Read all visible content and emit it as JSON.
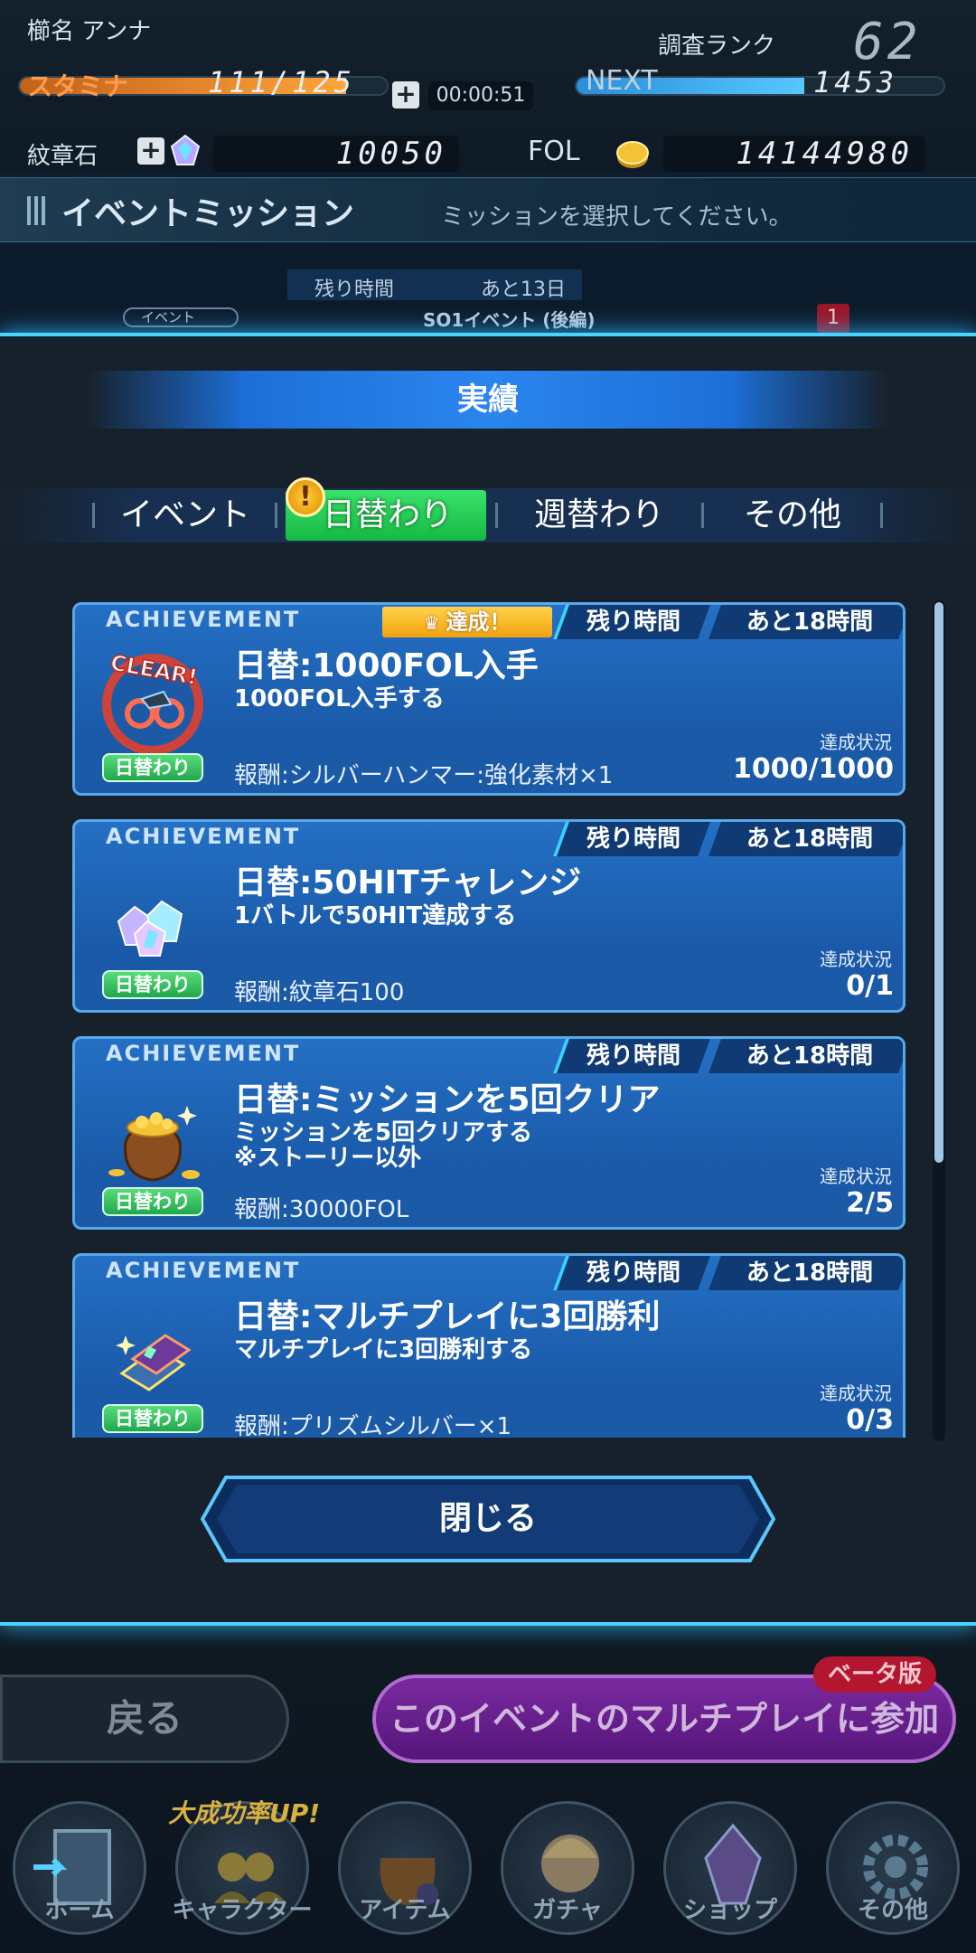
{
  "status": {
    "player_name": "櫛名 アンナ",
    "rank_label": "調査ランク",
    "rank_value": "62",
    "stamina_label": "スタミナ",
    "stamina_value": "111/125",
    "stamina_fraction": 0.89,
    "timer": "00:00:51",
    "next_label": "NEXT",
    "next_value": "1453",
    "next_fraction": 0.62,
    "crest_label": "紋章石",
    "crest_value": "10050",
    "fol_label": "FOL",
    "fol_value": "14144980"
  },
  "event_header": {
    "title": "イベントミッション",
    "instruction": "ミッションを選択してください。",
    "remaining_label": "残り時間",
    "remaining_value": "あと13日",
    "event_tag": "イベント",
    "event_name": "SO1イベント (後編)",
    "count": "1"
  },
  "modal": {
    "title": "実績",
    "tabs": [
      {
        "label": "イベント",
        "active": false
      },
      {
        "label": "日替わり",
        "active": true,
        "badge": "!"
      },
      {
        "label": "週替わり",
        "active": false
      },
      {
        "label": "その他",
        "active": false
      }
    ],
    "missions": [
      {
        "category": "ACHIEVEMENT",
        "achieved_label": "達成！",
        "remaining_label": "残り時間",
        "remaining_value": "あと18時間",
        "title": "日替:1000FOL入手",
        "desc": "1000FOL入手する",
        "progress_label": "達成状況",
        "progress": "1000/1000",
        "reward": "報酬:シルバーハンマー:強化素材×1",
        "chip": "日替わり",
        "icon": "clear-medal-icon",
        "clear_text": "CLEAR!"
      },
      {
        "category": "ACHIEVEMENT",
        "remaining_label": "残り時間",
        "remaining_value": "あと18時間",
        "title": "日替:50HITチャレンジ",
        "desc": "1バトルで50HIT達成する",
        "progress_label": "達成状況",
        "progress": "0/1",
        "reward": "報酬:紋章石100",
        "chip": "日替わり",
        "icon": "crest-stones-icon"
      },
      {
        "category": "ACHIEVEMENT",
        "remaining_label": "残り時間",
        "remaining_value": "あと18時間",
        "title": "日替:ミッションを5回クリア",
        "desc": "ミッションを5回クリアする\n※ストーリー以外",
        "progress_label": "達成状況",
        "progress": "2/5",
        "reward": "報酬:30000FOL",
        "chip": "日替わり",
        "icon": "gold-bag-icon"
      },
      {
        "category": "ACHIEVEMENT",
        "remaining_label": "残り時間",
        "remaining_value": "あと18時間",
        "title": "日替:マルチプレイに3回勝利",
        "desc": "マルチプレイに3回勝利する",
        "progress_label": "達成状況",
        "progress": "0/3",
        "reward": "報酬:プリズムシルバー×1",
        "chip": "日替わり",
        "icon": "prism-silver-icon"
      }
    ],
    "close_label": "閉じる"
  },
  "bottom": {
    "back_label": "戻る",
    "join_label": "このイベントのマルチプレイに参加",
    "beta_label": "ベータ版",
    "promo_label": "大成功率UP!",
    "nav": [
      "ホーム",
      "キャラクター",
      "アイテム",
      "ガチャ",
      "ショップ",
      "その他"
    ]
  },
  "colors": {
    "accent": "#4bd3ff",
    "card": "#1f63b6",
    "tab_active": "#2ccd57",
    "achieved": "#f5b21a"
  }
}
